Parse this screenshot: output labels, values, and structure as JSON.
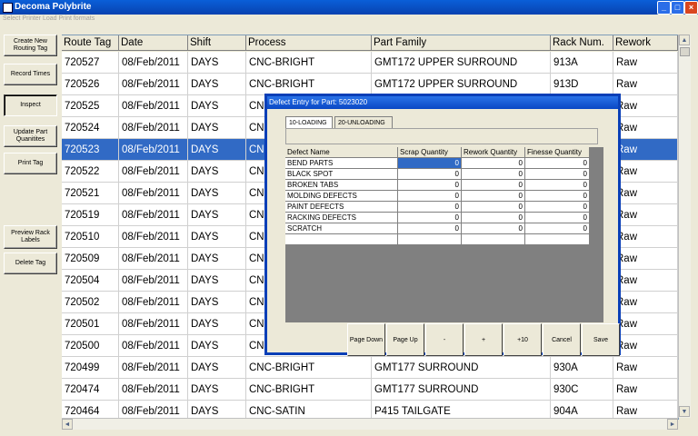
{
  "window": {
    "title": "Decoma Polybrite",
    "min": "_",
    "max": "□",
    "close": "×"
  },
  "menu": {
    "items": [
      "Select Printer",
      "Load Print formats"
    ]
  },
  "left_buttons": [
    {
      "label": "Create New Routing Tag"
    },
    {
      "label": "Record Times"
    },
    {
      "label": "Inspect"
    },
    {
      "label": "Update Part Quanitites"
    },
    {
      "label": "Print Tag"
    },
    {
      "label": "Preview Rack Labels"
    },
    {
      "label": "Delete Tag"
    }
  ],
  "grid": {
    "columns": [
      "Route Tag",
      "Date",
      "Shift",
      "Process",
      "Part Family",
      "Rack Num.",
      "Rework"
    ],
    "rows": [
      [
        "720527",
        "08/Feb/2011",
        "DAYS",
        "CNC-BRIGHT",
        "GMT172 UPPER SURROUND",
        "913A",
        "Raw"
      ],
      [
        "720526",
        "08/Feb/2011",
        "DAYS",
        "CNC-BRIGHT",
        "GMT172 UPPER SURROUND",
        "913D",
        "Raw"
      ],
      [
        "720525",
        "08/Feb/2011",
        "DAYS",
        "CN",
        "",
        "",
        "Raw"
      ],
      [
        "720524",
        "08/Feb/2011",
        "DAYS",
        "CN",
        "",
        "",
        "Raw"
      ],
      [
        "720523",
        "08/Feb/2011",
        "DAYS",
        "CN",
        "",
        "",
        "Raw"
      ],
      [
        "720522",
        "08/Feb/2011",
        "DAYS",
        "CN",
        "",
        "",
        "Raw"
      ],
      [
        "720521",
        "08/Feb/2011",
        "DAYS",
        "CN",
        "",
        "",
        "Raw"
      ],
      [
        "720519",
        "08/Feb/2011",
        "DAYS",
        "CN",
        "",
        "",
        "Raw"
      ],
      [
        "720510",
        "08/Feb/2011",
        "DAYS",
        "CN",
        "",
        "",
        "Raw"
      ],
      [
        "720509",
        "08/Feb/2011",
        "DAYS",
        "CN",
        "",
        "",
        "Raw"
      ],
      [
        "720504",
        "08/Feb/2011",
        "DAYS",
        "CN",
        "",
        "",
        "Raw"
      ],
      [
        "720502",
        "08/Feb/2011",
        "DAYS",
        "CN",
        "",
        "",
        "Raw"
      ],
      [
        "720501",
        "08/Feb/2011",
        "DAYS",
        "CN",
        "",
        "",
        "Raw"
      ],
      [
        "720500",
        "08/Feb/2011",
        "DAYS",
        "CN",
        "",
        "",
        "Raw"
      ],
      [
        "720499",
        "08/Feb/2011",
        "DAYS",
        "CNC-BRIGHT",
        "GMT177 SURROUND",
        "930A",
        "Raw"
      ],
      [
        "720474",
        "08/Feb/2011",
        "DAYS",
        "CNC-BRIGHT",
        "GMT177 SURROUND",
        "930C",
        "Raw"
      ],
      [
        "720464",
        "08/Feb/2011",
        "DAYS",
        "CNC-SATIN",
        "P415 TAILGATE",
        "904A",
        "Raw"
      ]
    ],
    "selected_row": 4
  },
  "dialog": {
    "title": "Defect Entry for Part: 5023020",
    "tabs": [
      "10-LOADING",
      "20-UNLOADING"
    ],
    "columns": [
      "Defect Name",
      "Scrap Quantity",
      "Rework Quantity",
      "Finesse Quantity"
    ],
    "rows": [
      [
        "BEND PARTS",
        "0",
        "0",
        "0"
      ],
      [
        "BLACK SPOT",
        "0",
        "0",
        "0"
      ],
      [
        "BROKEN TABS",
        "0",
        "0",
        "0"
      ],
      [
        "MOLDING DEFECTS",
        "0",
        "0",
        "0"
      ],
      [
        "PAINT DEFECTS",
        "0",
        "0",
        "0"
      ],
      [
        "RACKING DEFECTS",
        "0",
        "0",
        "0"
      ],
      [
        "SCRATCH",
        "0",
        "0",
        "0"
      ]
    ],
    "buttons": [
      "Page Down",
      "Page Up",
      "-",
      "+",
      "+10",
      "Cancel",
      "Save"
    ]
  },
  "colors": {
    "selection": "#316ac5",
    "titlebar": "#0a47c4"
  }
}
